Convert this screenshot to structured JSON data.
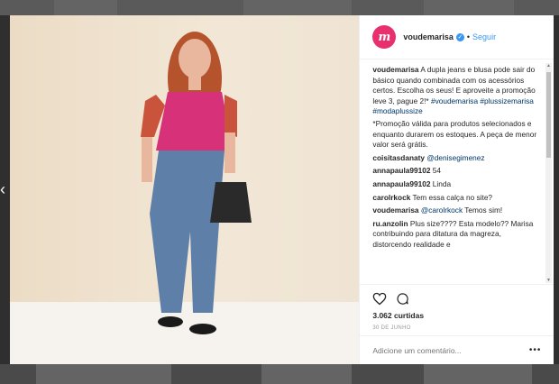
{
  "post": {
    "username": "voudemarisa",
    "avatar_letters": "m",
    "verified_icon": "✓",
    "separator": "•",
    "follow_label": "Seguir",
    "caption": {
      "username": "voudemarisa",
      "text": "A dupla jeans e blusa pode sair do básico quando combinada com os acessórios certos. Escolha os seus! E aproveite a promoção leve 3, pague 2!*",
      "hashtags": [
        "#voudemarisa",
        "#plussizemarisa",
        "#modaplussize"
      ],
      "note": "*Promoção válida para produtos selecionados e enquanto durarem os estoques. A peça de menor valor será grátis."
    },
    "comments": [
      {
        "username": "coisitasdanaty",
        "mention": "@denisegimenez",
        "text": ""
      },
      {
        "username": "annapaula99102",
        "mention": "",
        "text": "54"
      },
      {
        "username": "annapaula99102",
        "mention": "",
        "text": "Linda"
      },
      {
        "username": "carolrkock",
        "mention": "",
        "text": "Tem essa calça no site?"
      },
      {
        "username": "voudemarisa",
        "mention": "@carolrkock",
        "text": "Temos sim!"
      },
      {
        "username": "ru.anzolin",
        "mention": "",
        "text": "Plus size???? Esta modelo?? Marisa contribuindo para ditatura da magreza, distorcendo realidade e"
      }
    ],
    "likes": "3.062 curtidas",
    "date": "30 DE JUNHO",
    "comment_placeholder": "Adicione um comentário...",
    "more_icon": "•••"
  },
  "icons": {
    "like": "heart-icon",
    "comment": "comment-bubble-icon",
    "prev": "chevron-left-icon"
  },
  "colors": {
    "brand": "#e8306e",
    "link": "#3897f0",
    "hashtag": "#003569"
  }
}
